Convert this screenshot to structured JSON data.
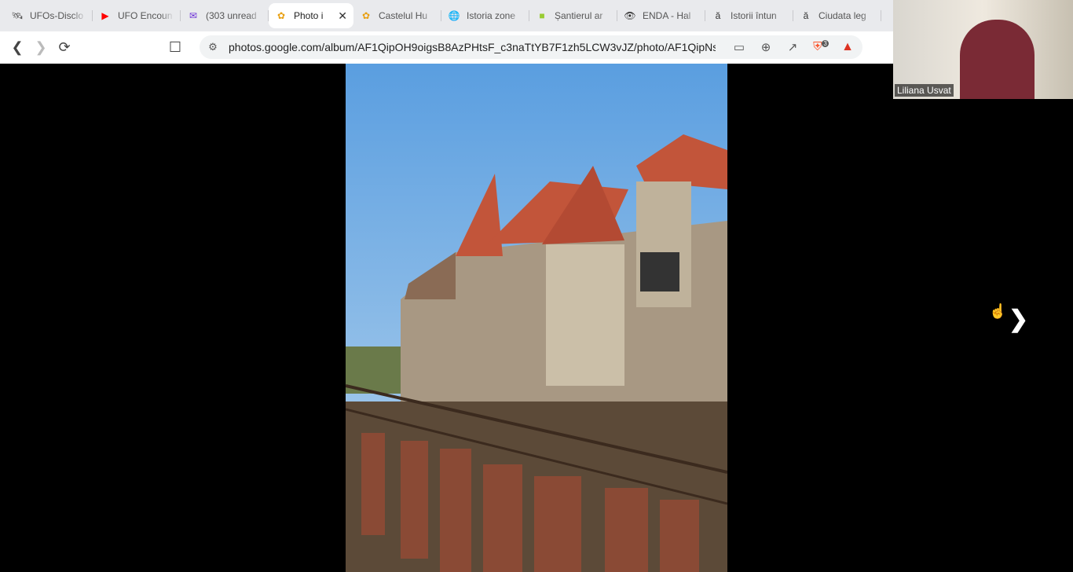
{
  "tabs": [
    {
      "label": "UFOs-Disclo",
      "icon": "satellite-icon"
    },
    {
      "label": "UFO Encoun",
      "icon": "youtube-icon"
    },
    {
      "label": "(303 unread",
      "icon": "mail-icon"
    },
    {
      "label": "Photo i",
      "icon": "google-photos-icon",
      "active": true
    },
    {
      "label": "Castelul Hu",
      "icon": "google-photos-icon"
    },
    {
      "label": "Istoria zone",
      "icon": "globe-icon"
    },
    {
      "label": "Șantierul ar",
      "icon": "site-icon"
    },
    {
      "label": "ENDA - Hal",
      "icon": "eye-icon"
    },
    {
      "label": "Istorii întun",
      "icon": "a-icon"
    },
    {
      "label": "Ciudata leg",
      "icon": "a-icon"
    }
  ],
  "url": "photos.google.com/album/AF1QipOH9oigsB8AzPHtsF_c3naTtYB7F1zh5LCW3vJZ/photo/AF1QipNs...",
  "brave_badge": "3",
  "video": {
    "name": "Liliana Usvat"
  },
  "colors": {
    "sky": "#6aa9e0",
    "roof": "#c2553a",
    "stone": "#a89883"
  }
}
